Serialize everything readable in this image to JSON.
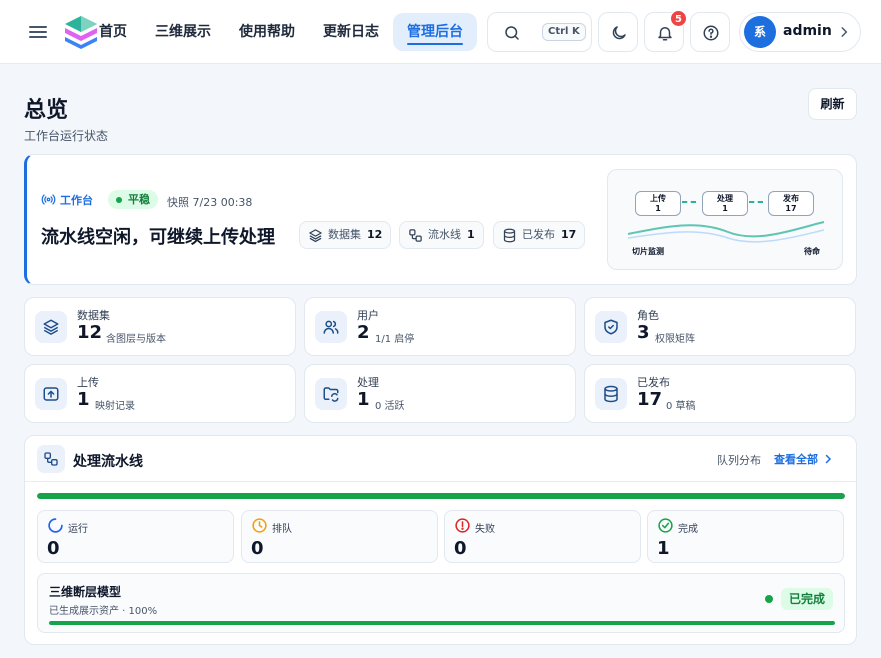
{
  "nav": {
    "items": [
      "首页",
      "三维展示",
      "使用帮助",
      "更新日志",
      "管理后台"
    ],
    "active_index": 4
  },
  "header": {
    "search_shortcut": "Ctrl K",
    "notification_count": "5",
    "user": {
      "avatar_text": "系",
      "name": "admin"
    },
    "icons": [
      "menu-icon",
      "app-logo",
      "search-icon",
      "moon-icon",
      "bell-icon",
      "help-icon",
      "chevron-right-icon"
    ]
  },
  "page": {
    "title": "总览",
    "subtitle": "工作台运行状态",
    "refresh_label": "刷新"
  },
  "hero": {
    "tag": "工作台",
    "state": "平稳",
    "snapshot": "快照 7/23 00:38",
    "headline": "流水线空闲，可继续上传处理",
    "chips": [
      {
        "label": "数据集",
        "value": "12",
        "icon": "layers-icon"
      },
      {
        "label": "流水线",
        "value": "1",
        "icon": "workflow-icon"
      },
      {
        "label": "已发布",
        "value": "17",
        "icon": "database-icon"
      }
    ],
    "flow": {
      "nodes": [
        {
          "label": "上传",
          "value": "1"
        },
        {
          "label": "处理",
          "value": "1"
        },
        {
          "label": "发布",
          "value": "17"
        }
      ],
      "footer_left": "切片监测",
      "footer_right": "待命"
    }
  },
  "stats": [
    {
      "label": "数据集",
      "value": "12",
      "sub": "含图层与版本",
      "icon": "layers-icon"
    },
    {
      "label": "用户",
      "value": "2",
      "sub": "1/1 启停",
      "icon": "users-icon"
    },
    {
      "label": "角色",
      "value": "3",
      "sub": "权限矩阵",
      "icon": "shield-icon"
    },
    {
      "label": "上传",
      "value": "1",
      "sub": "映射记录",
      "icon": "upload-icon"
    },
    {
      "label": "处理",
      "value": "1",
      "sub": "0 活跃",
      "icon": "folder-sync-icon"
    },
    {
      "label": "已发布",
      "value": "17",
      "sub": "0 草稿",
      "icon": "database-icon"
    }
  ],
  "pipeline": {
    "title": "处理流水线",
    "distribution_label": "队列分布",
    "view_all": "查看全部",
    "overall_progress": 1.0,
    "status": [
      {
        "label": "运行",
        "value": "0",
        "icon": "spinner-icon",
        "color": "#2563eb"
      },
      {
        "label": "排队",
        "value": "0",
        "icon": "clock-icon",
        "color": "#f59e0b"
      },
      {
        "label": "失败",
        "value": "0",
        "icon": "alert-circle-icon",
        "color": "#dc2626"
      },
      {
        "label": "完成",
        "value": "1",
        "icon": "check-circle-icon",
        "color": "#16a34a"
      }
    ],
    "job": {
      "title": "三维断层模型",
      "subtitle": "已生成展示资产 · 100%",
      "status": "已完成",
      "progress": 1.0
    }
  },
  "colors": {
    "accent": "#1d6fe0",
    "success": "#16a34a",
    "success_bg": "#dcfce7",
    "danger": "#ef4444",
    "warning": "#f59e0b"
  }
}
